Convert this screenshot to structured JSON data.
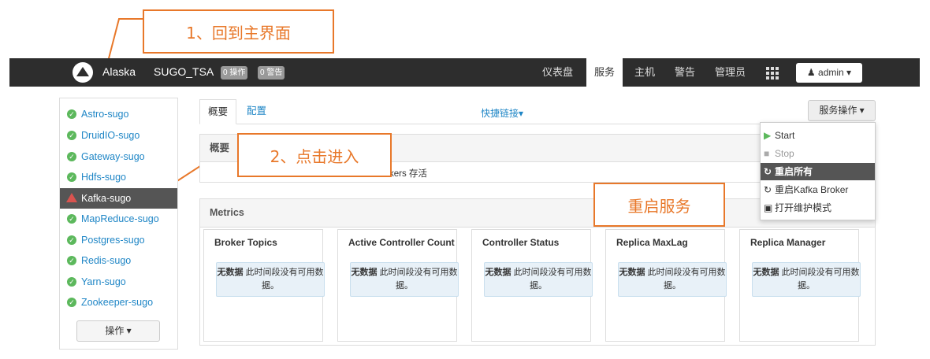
{
  "annotations": {
    "step1": "1、回到主界面",
    "step2": "2、点击进入",
    "restart": "重启服务"
  },
  "navbar": {
    "brand": "Alaska",
    "cluster": "SUGO_TSA",
    "ops_badge": "0 操作",
    "alerts_badge": "0 警告",
    "links": [
      "仪表盘",
      "服务",
      "主机",
      "警告",
      "管理员"
    ],
    "active_link": "服务",
    "user": "admin"
  },
  "sidebar": {
    "services": [
      {
        "name": "Astro-sugo",
        "status": "ok"
      },
      {
        "name": "DruidIO-sugo",
        "status": "ok"
      },
      {
        "name": "Gateway-sugo",
        "status": "ok"
      },
      {
        "name": "Hdfs-sugo",
        "status": "ok"
      },
      {
        "name": "Kafka-sugo",
        "status": "warning"
      },
      {
        "name": "MapReduce-sugo",
        "status": "ok"
      },
      {
        "name": "Postgres-sugo",
        "status": "ok"
      },
      {
        "name": "Redis-sugo",
        "status": "ok"
      },
      {
        "name": "Yarn-sugo",
        "status": "ok"
      },
      {
        "name": "Zookeeper-sugo",
        "status": "ok"
      }
    ],
    "actions_button": "操作"
  },
  "main": {
    "tabs": [
      "概要",
      "配置"
    ],
    "quick_links": "快捷链接",
    "service_actions": "服务操作",
    "summary_title": "概要",
    "summary_text": "kers 存活",
    "metrics_title": "Metrics",
    "no_data_bold": "无数据",
    "no_data_text": "此时间段没有可用数据。",
    "metrics": [
      "Broker Topics",
      "Active Controller Count",
      "Controller Status",
      "Replica MaxLag",
      "Replica Manager"
    ]
  },
  "service_menu": {
    "items": [
      {
        "label": "Start",
        "icon": "play-icon",
        "state": "normal"
      },
      {
        "label": "Stop",
        "icon": "stop-icon",
        "state": "disabled"
      },
      {
        "label": "重启所有",
        "icon": "refresh-icon",
        "state": "highlighted"
      },
      {
        "label": "重启Kafka Broker",
        "icon": "refresh-icon",
        "state": "normal"
      },
      {
        "label": "打开维护模式",
        "icon": "medkit-icon",
        "state": "normal"
      }
    ]
  },
  "colors": {
    "annotation": "#e8782a",
    "navbar": "#2d2d2d",
    "link": "#1f86c6",
    "ok": "#5cb85c",
    "warning": "#d9534f"
  }
}
